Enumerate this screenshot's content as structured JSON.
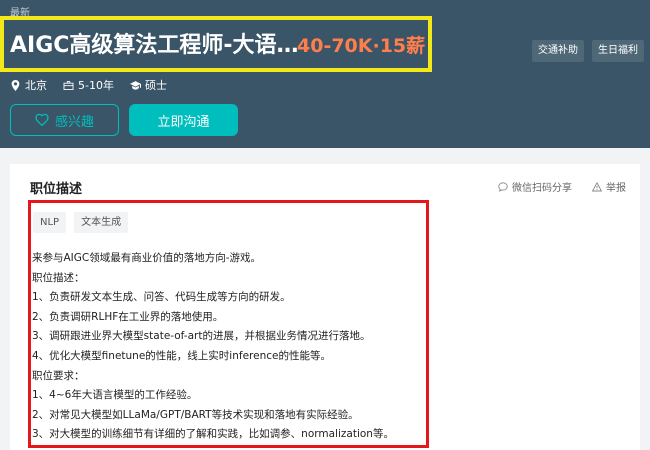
{
  "header": {
    "tag": "最新",
    "job_title": "AIGC高级算法工程师-大语…",
    "salary": "40-70K·15薪",
    "benefits": [
      "交通补助",
      "生日福利"
    ],
    "meta": {
      "city": "北京",
      "experience": "5-10年",
      "degree": "硕士"
    },
    "interest_label": "感兴趣",
    "chat_label": "立即沟通"
  },
  "card": {
    "section_title": "职位描述",
    "share_label": "微信扫码分享",
    "report_label": "举报",
    "tags": [
      "NLP",
      "文本生成"
    ],
    "lines": [
      "来参与AIGC领域最有商业价值的落地方向-游戏。",
      "职位描述：",
      "1、负责研发文本生成、问答、代码生成等方向的研发。",
      "2、负责调研RLHF在工业界的落地使用。",
      "3、调研跟进业界大模型state-of-art的进展，并根据业务情况进行落地。",
      "4、优化大模型finetune的性能，线上实时inference的性能等。",
      "职位要求：",
      "1、4~6年大语言模型的工作经验。",
      "2、对常见大模型如LLaMa/GPT/BART等技术实现和落地有实际经验。",
      "3、对大模型的训练细节有详细的了解和实践，比如调参、normalization等。"
    ]
  },
  "colors": {
    "header_bg": "#3a5567",
    "accent": "#00bebd",
    "salary": "#ff7e4b",
    "highlight_yellow": "#f2ea18",
    "highlight_red": "#e4171b"
  }
}
